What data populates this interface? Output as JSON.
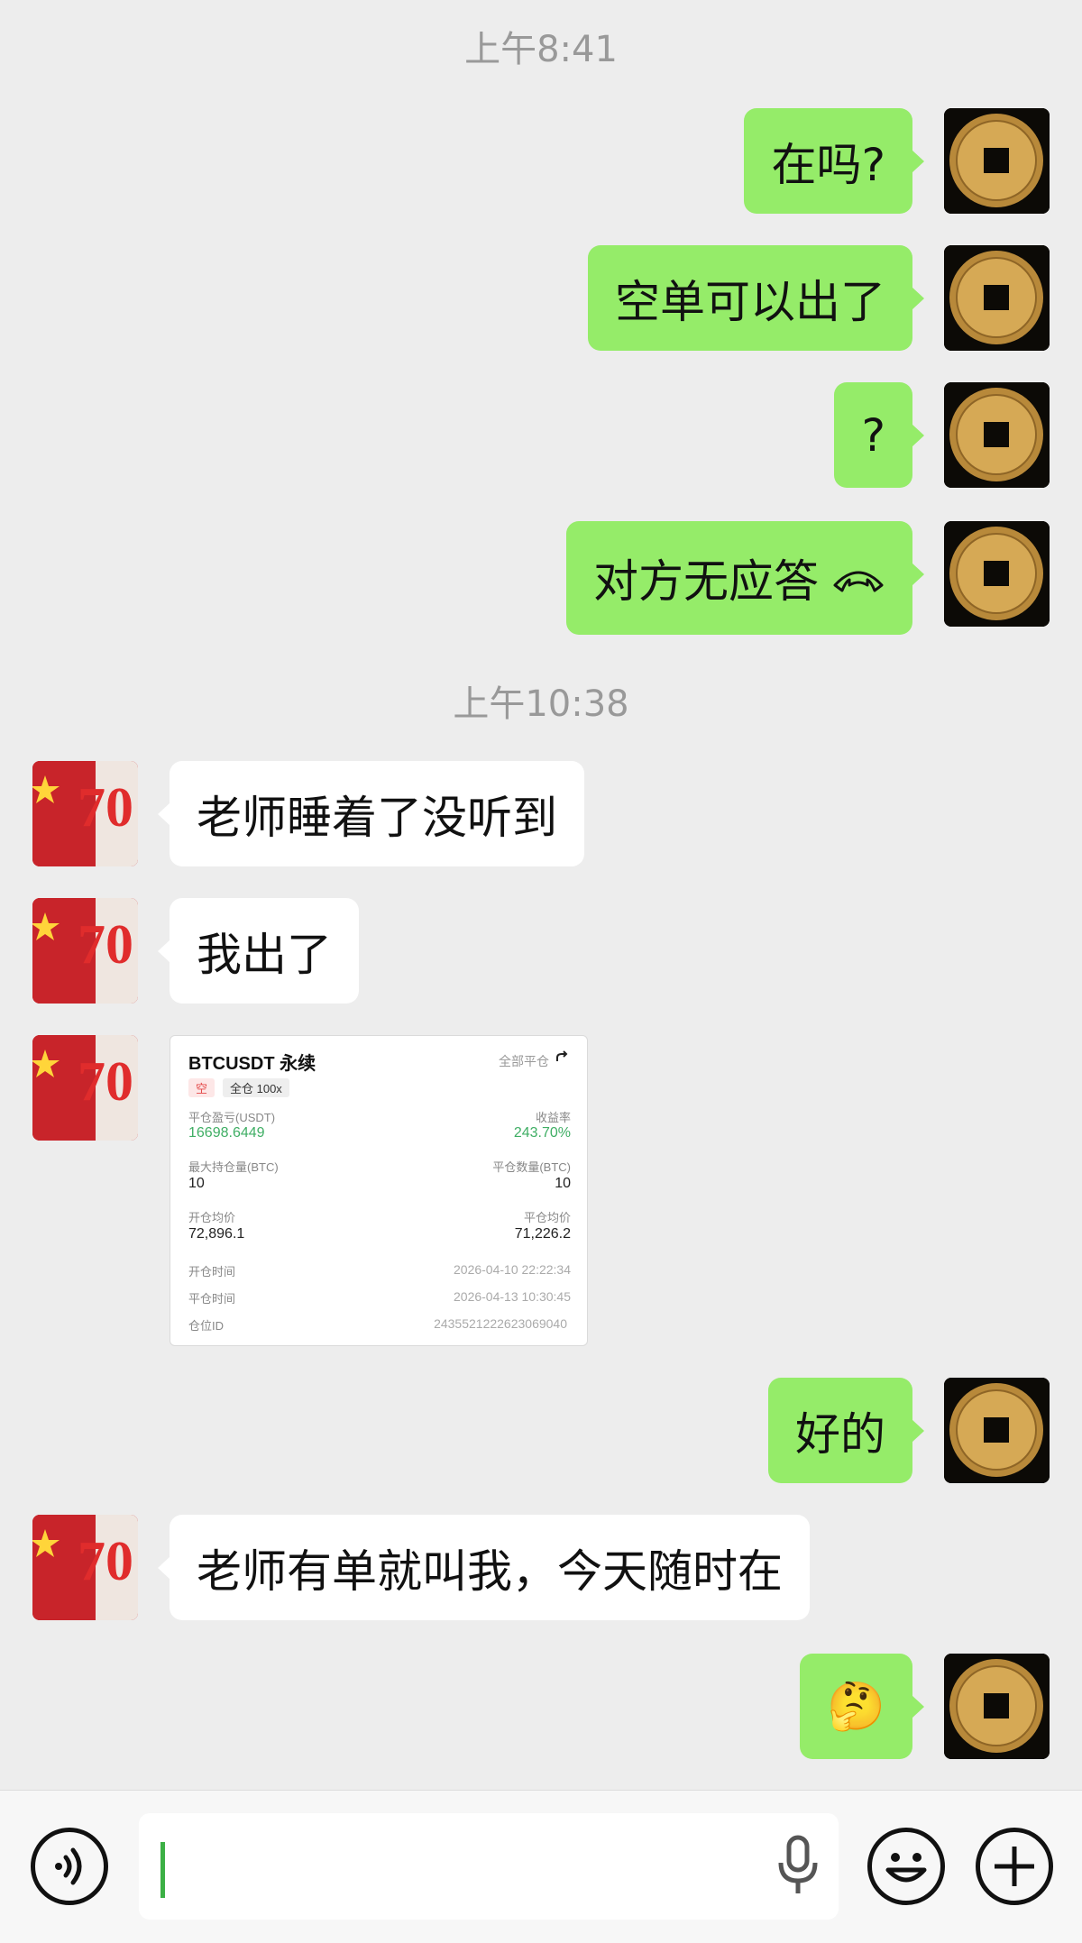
{
  "timestamps": [
    "上午8:41",
    "上午10:38"
  ],
  "messages": {
    "m1": "在吗?",
    "m2": "空单可以出了",
    "m3": "?",
    "m4": "对方无应答",
    "m5": "老师睡着了没听到",
    "m6": "我出了",
    "m8": "好的",
    "m9": "老师有单就叫我，今天随时在",
    "m10": "🤔"
  },
  "card": {
    "title": "BTCUSDT 永续",
    "close_all": "全部平仓",
    "tag_side": "空",
    "tag_mode": "全仓 100x",
    "pnl_label": "平仓盈亏(USDT)",
    "pnl_value": "16698.6449",
    "roi_label": "收益率",
    "roi_value": "243.70%",
    "max_pos_label": "最大持仓量(BTC)",
    "max_pos_value": "10",
    "close_qty_label": "平仓数量(BTC)",
    "close_qty_value": "10",
    "open_avg_label": "开仓均价",
    "open_avg_value": "72,896.1",
    "close_avg_label": "平仓均价",
    "close_avg_value": "71,226.2",
    "open_time_label": "开仓时间",
    "open_time_value": "2026-04-10 22:22:34",
    "close_time_label": "平仓时间",
    "close_time_value": "2026-04-13 10:30:45",
    "position_id_label": "仓位ID",
    "position_id_value": "2435521222623069040"
  },
  "colors": {
    "background": "#ededed",
    "my_bubble": "#95ec69",
    "their_bubble": "#ffffff",
    "profit_green": "#3fae64",
    "short_red": "#e44a4a"
  },
  "icons": {
    "voice_toggle": "voice-wave-icon",
    "mic": "microphone-icon",
    "emoji": "smiley-icon",
    "more": "plus-icon",
    "call": "phone-hangup-icon"
  }
}
